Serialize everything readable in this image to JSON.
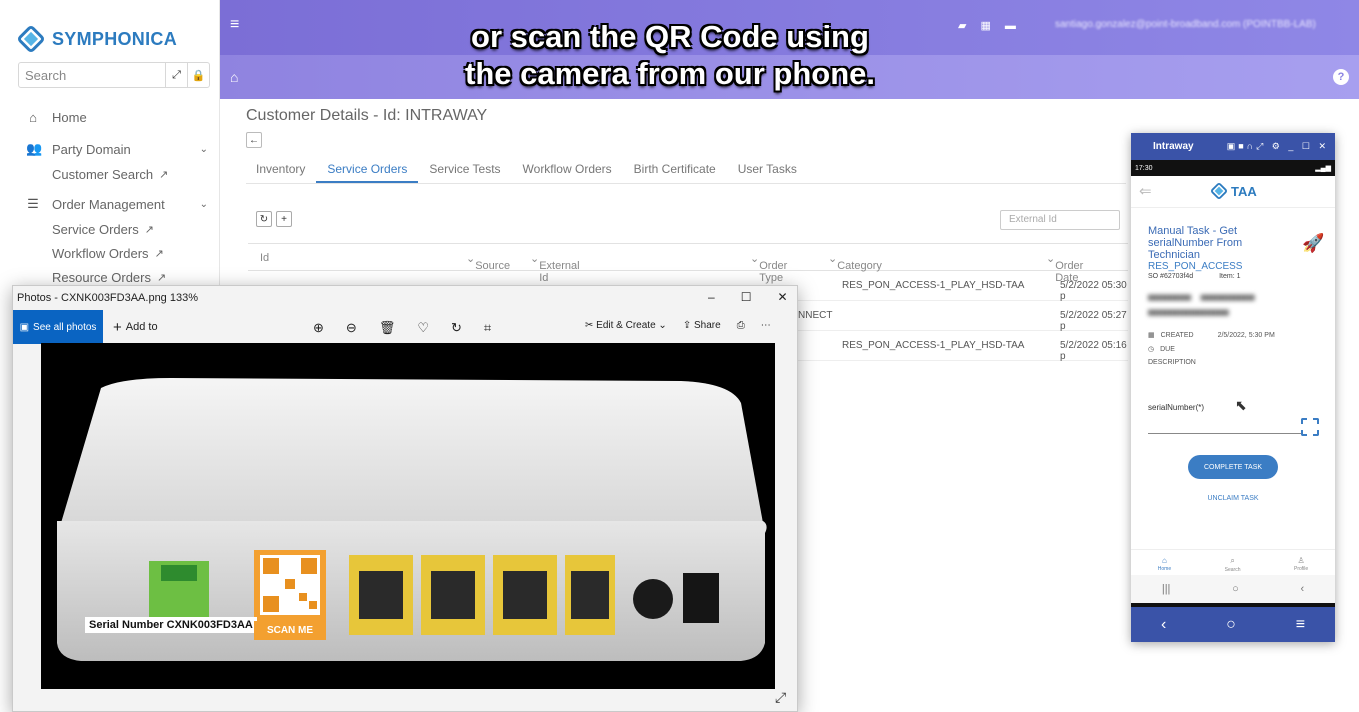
{
  "caption": {
    "line1": "or scan the QR Code using",
    "line2": "the camera from our phone."
  },
  "sidebar": {
    "brand": "SYMPHONICA",
    "search_placeholder": "Search",
    "items": [
      {
        "label": "Home",
        "icon": "home-icon"
      },
      {
        "label": "Party Domain",
        "icon": "users-icon"
      },
      {
        "label": "Customer Search"
      },
      {
        "label": "Order Management",
        "icon": "list-icon"
      },
      {
        "label": "Service Orders"
      },
      {
        "label": "Workflow Orders"
      },
      {
        "label": "Resource Orders"
      }
    ]
  },
  "header": {
    "user": "santiago.gonzalez@point-broadband.com (POINTBB-LAB)"
  },
  "main": {
    "title": "Customer Details - Id: INTRAWAY",
    "tabs": [
      "Inventory",
      "Service Orders",
      "Service Tests",
      "Workflow Orders",
      "Birth Certificate",
      "User Tasks"
    ],
    "active_tab": "Service Orders",
    "external_id_placeholder": "External Id",
    "columns": [
      "Id",
      "Source",
      "External Id",
      "Order Type",
      "Category",
      "Order Date"
    ],
    "rows": [
      {
        "category": "RES_PON_ACCESS-1_PLAY_HSD-TAA",
        "date": "5/2/2022 05:30 p"
      },
      {
        "order_type": "NNECT",
        "date": "5/2/2022 05:27 p"
      },
      {
        "category": "RES_PON_ACCESS-1_PLAY_HSD-TAA",
        "date": "5/2/2022 05:16 p"
      }
    ]
  },
  "photos": {
    "title": "Photos - CXNK003FD3AA.png  133%",
    "see_all": "See all photos",
    "add_to": "Add to",
    "edit_create": "Edit & Create",
    "share": "Share",
    "serial_label": "Serial Number CXNK003FD3AA",
    "scan_me": "SCAN ME"
  },
  "phone": {
    "window_title": "Intraway",
    "status_time": "17:30",
    "app_name": "TAA",
    "task_title": "Manual Task - Get serialNumber From Technician",
    "task_category": "RES_PON_ACCESS",
    "so_line": "SO #62703f4d",
    "item_line": "Item: 1",
    "created_label": "CREATED",
    "created_value": "2/5/2022, 5:30 PM",
    "due_label": "DUE",
    "description_label": "DESCRIPTION",
    "serial_field_label": "serialNumber(*)",
    "complete_btn": "COMPLETE TASK",
    "unclaim_btn": "UNCLAIM TASK",
    "nav": [
      "Home",
      "Search",
      "Profile"
    ]
  }
}
